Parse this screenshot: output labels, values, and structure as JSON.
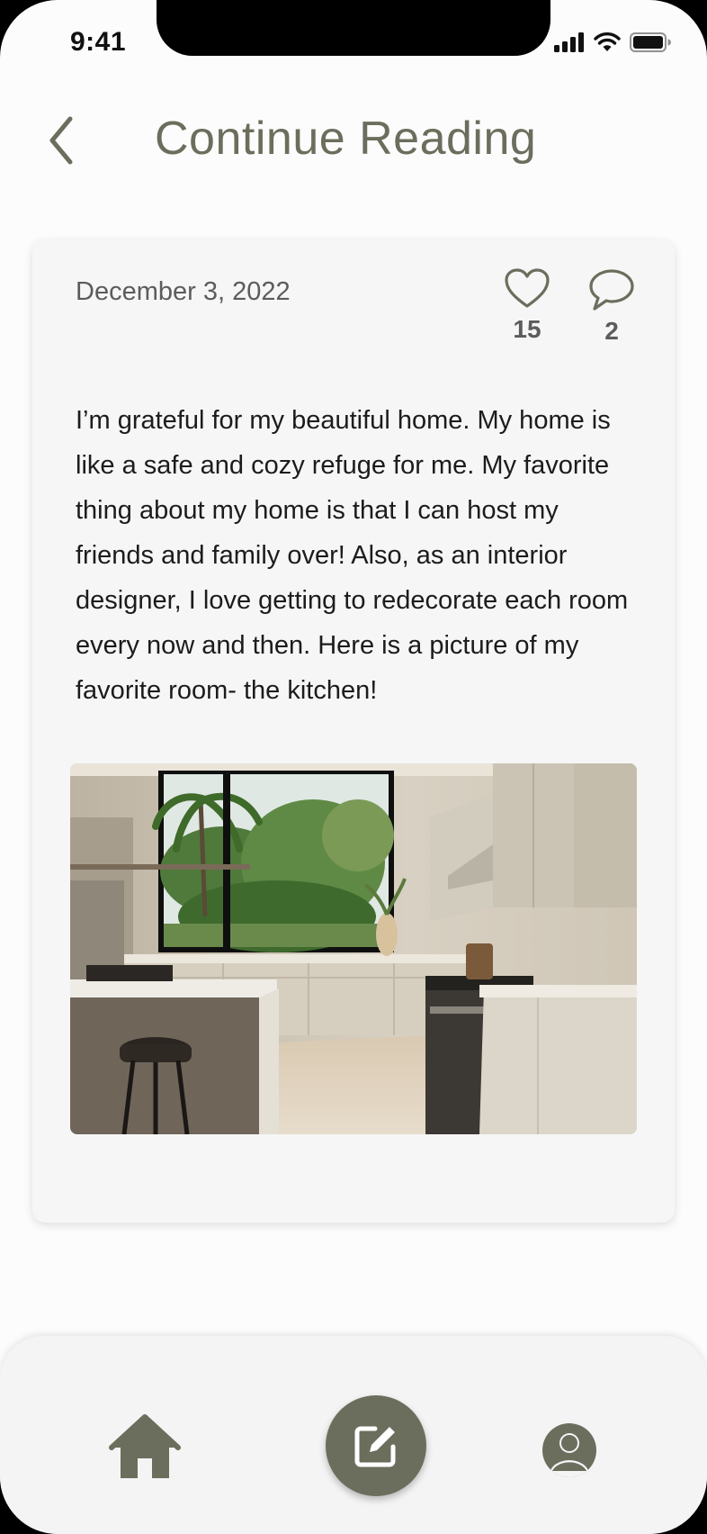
{
  "status_bar": {
    "time": "9:41",
    "icons": [
      "signal-icon",
      "wifi-icon",
      "battery-icon"
    ]
  },
  "header": {
    "title": "Continue Reading",
    "back_icon": "chevron-left-icon"
  },
  "entry": {
    "date": "December 3, 2022",
    "likes": "15",
    "comments": "2",
    "body": "I’m grateful for my beautiful home. My home is like a safe and cozy refuge for me. My favorite thing about my home is that I can host my friends and family over! Also, as an interior designer, I love getting to redecorate each room every now and then. Here is a picture of my favorite room- the kitchen!",
    "photo_subject": "kitchen"
  },
  "bottom_nav": {
    "items": [
      {
        "icon": "home-icon"
      },
      {
        "icon": "compose-icon"
      },
      {
        "icon": "profile-icon"
      }
    ]
  },
  "colors": {
    "accent": "#6b6e5c",
    "card": "#f6f6f6",
    "background": "#fcfcfc",
    "text": "#1c1c1c"
  }
}
